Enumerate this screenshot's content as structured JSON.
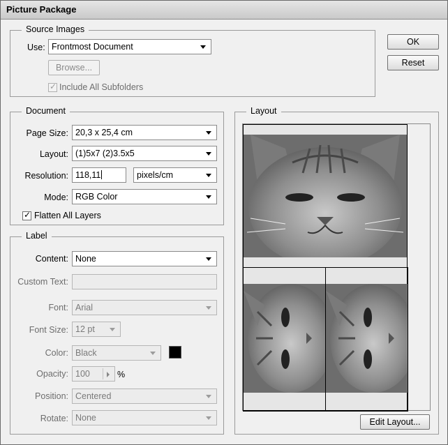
{
  "window": {
    "title": "Picture Package"
  },
  "buttons": {
    "ok": "OK",
    "reset": "Reset",
    "edit_layout": "Edit Layout..."
  },
  "source_images": {
    "legend": "Source Images",
    "use_label": "Use:",
    "use_value": "Frontmost Document",
    "browse_label": "Browse...",
    "include_subfolders_label": "Include All Subfolders",
    "include_subfolders_checked": true
  },
  "document": {
    "legend": "Document",
    "page_size_label": "Page Size:",
    "page_size_value": "20,3 x 25,4 cm",
    "layout_label": "Layout:",
    "layout_value": "(1)5x7 (2)3.5x5",
    "resolution_label": "Resolution:",
    "resolution_value": "118,11",
    "resolution_unit": "pixels/cm",
    "mode_label": "Mode:",
    "mode_value": "RGB Color",
    "flatten_label": "Flatten All Layers",
    "flatten_checked": true
  },
  "label": {
    "legend": "Label",
    "content_label": "Content:",
    "content_value": "None",
    "custom_text_label": "Custom Text:",
    "custom_text_value": "",
    "font_label": "Font:",
    "font_value": "Arial",
    "font_size_label": "Font Size:",
    "font_size_value": "12 pt",
    "color_label": "Color:",
    "color_value": "Black",
    "color_swatch": "#000000",
    "opacity_label": "Opacity:",
    "opacity_value": "100",
    "opacity_unit": "%",
    "position_label": "Position:",
    "position_value": "Centered",
    "rotate_label": "Rotate:",
    "rotate_value": "None"
  },
  "layout_panel": {
    "legend": "Layout",
    "thumbnails": [
      {
        "subject": "cat-photo",
        "orientation": "upright"
      },
      {
        "subject": "cat-photo",
        "orientation": "rotated"
      },
      {
        "subject": "cat-photo",
        "orientation": "rotated"
      }
    ]
  }
}
